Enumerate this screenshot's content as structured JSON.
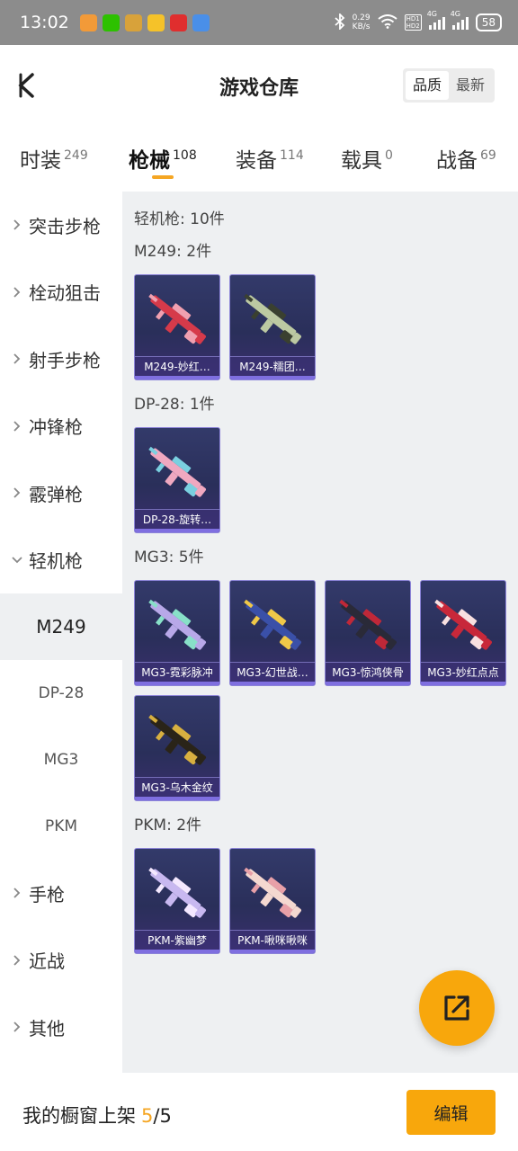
{
  "status_bar": {
    "time": "13:02",
    "net_speed_value": "0.29",
    "net_speed_unit": "KB/s",
    "hd1": "HD1",
    "hd2": "HD2",
    "sig1": "4G",
    "sig2": "4G",
    "battery": "58",
    "apps": [
      {
        "icon": "game-app-icon",
        "color": "#f29a38"
      },
      {
        "icon": "wechat-icon",
        "color": "#2dc100"
      },
      {
        "icon": "news-app-icon",
        "color": "#d8a23a"
      },
      {
        "icon": "meituan-icon",
        "color": "#f5c229"
      },
      {
        "icon": "red-c-app-icon",
        "color": "#e02e2e"
      },
      {
        "icon": "cloud-app-icon",
        "color": "#4a8fe8"
      }
    ]
  },
  "header": {
    "title": "游戏仓库",
    "sort": [
      "品质",
      "最新"
    ]
  },
  "category_tabs": [
    {
      "name": "时装",
      "count": "249"
    },
    {
      "name": "枪械",
      "count": "108",
      "active": true
    },
    {
      "name": "装备",
      "count": "114"
    },
    {
      "name": "载具",
      "count": "0"
    },
    {
      "name": "战备",
      "count": "69"
    }
  ],
  "sidebar": {
    "items_top": [
      "突击步枪",
      "栓动狙击",
      "射手步枪",
      "冲锋枪",
      "霰弹枪",
      "轻机枪"
    ],
    "sub_items": [
      "M249",
      "DP-28",
      "MG3",
      "PKM"
    ],
    "items_bottom": [
      "手枪",
      "近战",
      "其他"
    ],
    "active_sub": "M249"
  },
  "content": {
    "total": "轻机枪: 10件",
    "groups": [
      {
        "title": "M249: 2件",
        "items": [
          {
            "name": "M249-妙红…",
            "color": "#d63a4a",
            "accent": "#f0a0b0"
          },
          {
            "name": "M249-糯团…",
            "color": "#bcc9a2",
            "accent": "#3a4030"
          }
        ]
      },
      {
        "title": "DP-28: 1件",
        "items": [
          {
            "name": "DP-28-旋转…",
            "color": "#f0a8c0",
            "accent": "#7ad0e0"
          }
        ]
      },
      {
        "title": "MG3: 5件",
        "items": [
          {
            "name": "MG3-霓彩脉冲",
            "color": "#b8a8e8",
            "accent": "#88e0c8"
          },
          {
            "name": "MG3-幻世战…",
            "color": "#3a50a8",
            "accent": "#f0c848"
          },
          {
            "name": "MG3-惊鸿侠骨",
            "color": "#2a2a38",
            "accent": "#c02838"
          },
          {
            "name": "MG3-妙红点点",
            "color": "#c8283a",
            "accent": "#f8e0e0"
          },
          {
            "name": "MG3-乌木金纹",
            "color": "#2a2418",
            "accent": "#d8b040"
          }
        ]
      },
      {
        "title": "PKM: 2件",
        "items": [
          {
            "name": "PKM-紫幽梦",
            "color": "#c8b8f0",
            "accent": "#f4e8ff"
          },
          {
            "name": "PKM-啾咪啾咪",
            "color": "#f4d8d0",
            "accent": "#e8a0a8"
          }
        ]
      }
    ]
  },
  "bottom": {
    "label": "我的橱窗上架",
    "current": "5",
    "total": "/5",
    "edit": "编辑"
  },
  "accent_color": "#f8a70c"
}
